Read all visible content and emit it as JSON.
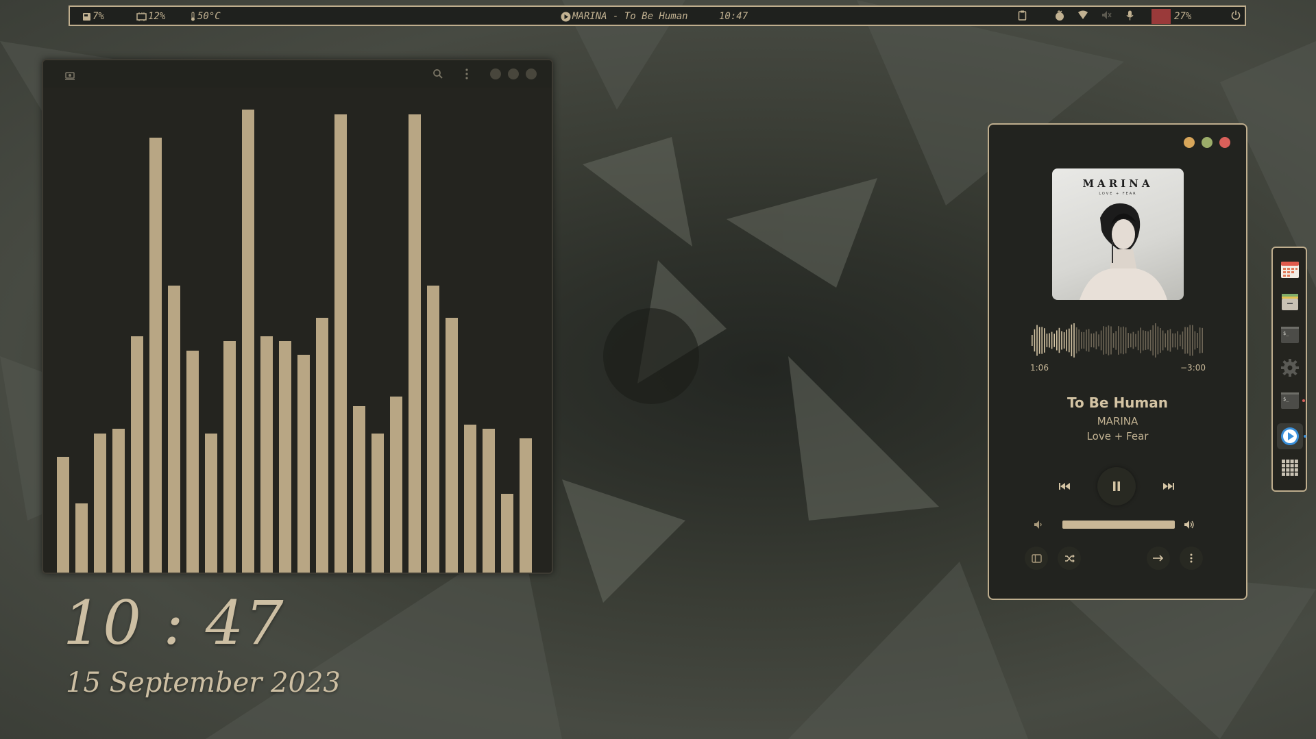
{
  "topbar": {
    "disk": "7%",
    "cpu": "12%",
    "temperature": "50°C",
    "now_playing": "MARINA - To Be Human",
    "time": "10:47",
    "battery": "27%"
  },
  "visualizer": {
    "bar_levels": [
      0.25,
      0.15,
      0.3,
      0.31,
      0.51,
      0.94,
      0.62,
      0.48,
      0.3,
      0.5,
      1.0,
      0.51,
      0.5,
      0.47,
      0.55,
      0.99,
      0.36,
      0.3,
      0.38,
      0.99,
      0.62,
      0.55,
      0.32,
      0.31,
      0.17,
      0.29
    ],
    "bar_color": "#b8a684"
  },
  "clock": {
    "time": "10 : 47",
    "date": "15 September 2023"
  },
  "player": {
    "album_art_artist": "MARINA",
    "album_art_subtitle": "LOVE + FEAR",
    "elapsed": "1:06",
    "remaining": "−3:00",
    "progress": 0.25,
    "title": "To Be Human",
    "artist": "MARINA",
    "album": "Love + Fear",
    "volume": 1.0,
    "accent": "#bfae8e"
  },
  "dock": {
    "items": [
      "calendar-icon",
      "files-icon",
      "terminal-icon",
      "settings-icon",
      "terminal-icon",
      "music-player-icon",
      "app-grid-icon"
    ]
  }
}
